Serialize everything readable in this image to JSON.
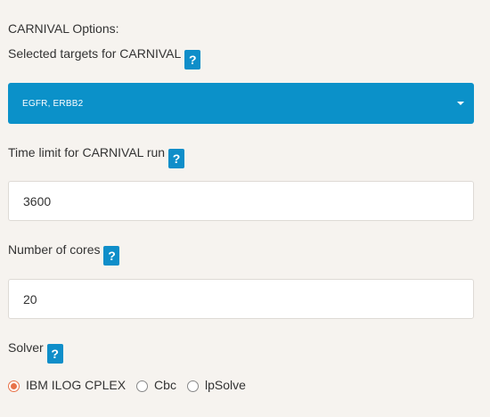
{
  "section_title": "CARNIVAL Options:",
  "targets": {
    "label": "Selected targets for CARNIVAL",
    "help": "?",
    "selected_value": "EGFR, ERBB2"
  },
  "time_limit": {
    "label": "Time limit for CARNIVAL run",
    "help": "?",
    "value": "3600"
  },
  "cores": {
    "label": "Number of cores",
    "help": "?",
    "value": "20"
  },
  "solver": {
    "label": "Solver",
    "help": "?",
    "options": [
      "IBM ILOG CPLEX",
      "Cbc",
      "lpSolve"
    ],
    "selected": "IBM ILOG CPLEX"
  },
  "colors": {
    "accent": "#0b91c9",
    "radio_selected": "#e8734a",
    "background": "#f6f3ef"
  },
  "icons": {
    "help": "question-mark",
    "select_caret": "caret-down"
  }
}
